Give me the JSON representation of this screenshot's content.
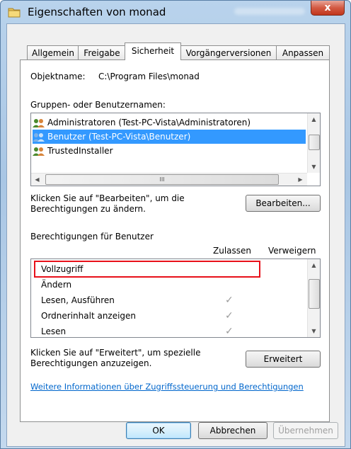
{
  "window": {
    "title": "Eigenschaften von monad",
    "close_label": "x"
  },
  "tabs": [
    {
      "label": "Allgemein"
    },
    {
      "label": "Freigabe"
    },
    {
      "label": "Sicherheit"
    },
    {
      "label": "Vorgängerversionen"
    },
    {
      "label": "Anpassen"
    }
  ],
  "object": {
    "label": "Objektname:",
    "value": "C:\\Program Files\\monad"
  },
  "groups": {
    "label": "Gruppen- oder Benutzernamen:",
    "items": [
      {
        "label": "Administratoren (Test-PC-Vista\\Administratoren)"
      },
      {
        "label": "Benutzer (Test-PC-Vista\\Benutzer)"
      },
      {
        "label": "TrustedInstaller"
      }
    ],
    "hscroll_glyph": "III"
  },
  "edit": {
    "hint": "Klicken Sie auf \"Bearbeiten\", um die",
    "hint2": "Berechtigungen zu ändern.",
    "button": "Bearbeiten..."
  },
  "permissions": {
    "label": "Berechtigungen für Benutzer",
    "col_allow": "Zulassen",
    "col_deny": "Verweigern",
    "rows": [
      {
        "label": "Vollzugriff"
      },
      {
        "label": "Ändern"
      },
      {
        "label": "Lesen, Ausführen",
        "allow": "✓"
      },
      {
        "label": "Ordnerinhalt anzeigen",
        "allow": "✓"
      },
      {
        "label": "Lesen",
        "allow": "✓"
      }
    ]
  },
  "advanced": {
    "hint": "Klicken Sie auf \"Erweitert\", um spezielle",
    "hint2": "Berechtigungen anzuzeigen.",
    "button": "Erweitert"
  },
  "info_link": "Weitere Informationen über Zugriffssteuerung und Berechtigungen",
  "buttons": {
    "ok": "OK",
    "cancel": "Abbrechen",
    "apply": "Übernehmen"
  }
}
